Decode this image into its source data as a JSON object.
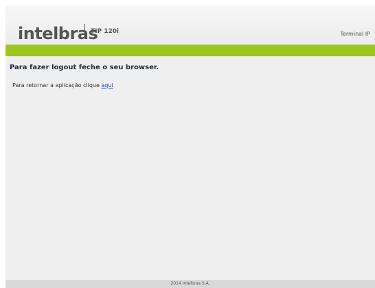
{
  "header": {
    "brand": "intelbras",
    "model": "TIP 120i",
    "device_label": "Terminal IP"
  },
  "main": {
    "heading": "Para fazer logout feche o seu browser.",
    "return_text": "Para retornar a aplicação clique",
    "return_link": "aqui"
  },
  "footer": {
    "copyright": "2014 Intelbras S.A."
  },
  "colors": {
    "accent_bar": "#9cc521",
    "link": "#1a3cc7"
  }
}
